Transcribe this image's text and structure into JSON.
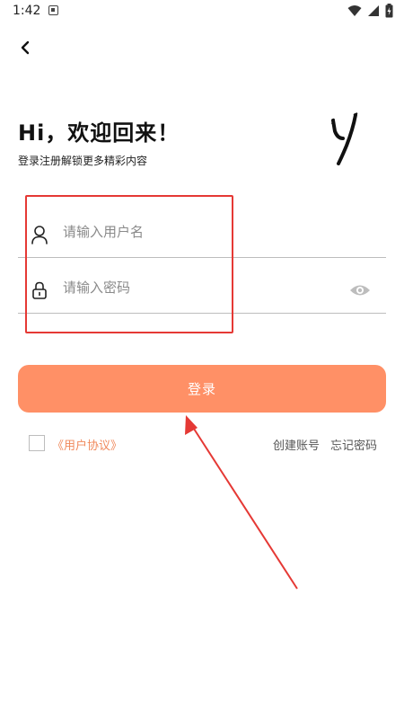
{
  "status_bar": {
    "time": "1:42"
  },
  "header": {
    "title": "Hi，欢迎回来！",
    "subtitle": "登录注册解锁更多精彩内容",
    "logo_icon": "brand-y-logo"
  },
  "form": {
    "username_placeholder": "请输入用户名",
    "password_placeholder": "请输入密码",
    "login_label": "登录",
    "accent_color": "#ff9066"
  },
  "footer": {
    "agreement_label": "《用户协议》",
    "create_account_label": "创建账号",
    "forgot_password_label": "忘记密码"
  },
  "annotations": {
    "color": "#e53935"
  }
}
